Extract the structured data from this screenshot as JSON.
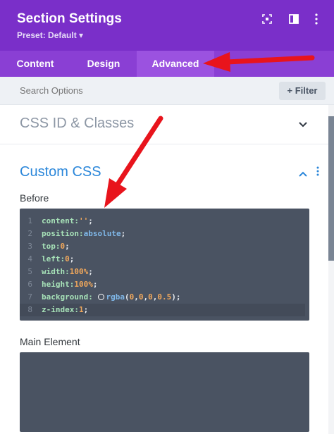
{
  "header": {
    "title": "Section Settings",
    "preset": "Preset: Default ▾",
    "icons": [
      "focus-icon",
      "split-view-icon",
      "more-vertical-icon"
    ]
  },
  "tabs": [
    {
      "label": "Content"
    },
    {
      "label": "Design"
    },
    {
      "label": "Advanced",
      "active": true
    }
  ],
  "search": {
    "placeholder": "Search Options",
    "filter_label": "+ Filter"
  },
  "sections": [
    {
      "title": "CSS ID & Classes",
      "expanded": false
    },
    {
      "title": "Custom CSS",
      "expanded": true
    }
  ],
  "fields": {
    "before_label": "Before",
    "main_label": "Main Element"
  },
  "code": {
    "line_numbers": [
      "1",
      "2",
      "3",
      "4",
      "5",
      "6",
      "7",
      "8"
    ],
    "active_line": 8,
    "l1": {
      "prop": "content:",
      "val": "''",
      "end": ";"
    },
    "l2": {
      "prop": "position:",
      "val": "absolute",
      "end": ";"
    },
    "l3": {
      "prop": "top:",
      "val": "0",
      "end": ";"
    },
    "l4": {
      "prop": "left:",
      "val": "0",
      "end": ";"
    },
    "l5": {
      "prop": "width:",
      "val": "100%",
      "end": ";"
    },
    "l6": {
      "prop": "height:",
      "val": "100%",
      "end": ";"
    },
    "l7": {
      "prop": "background:",
      "fn": "rgba",
      "open": "(",
      "a": "0",
      "b": "0",
      "c": "0",
      "d": "0.5",
      "close": ");"
    },
    "l8": {
      "prop": "z-index:",
      "val": "1",
      "end": ";"
    }
  },
  "colors": {
    "header": "#7a2fc9",
    "tabs": "#8a3fd4",
    "active_tab": "#9b52e0",
    "accent_title": "#2b87da",
    "editor_bg": "#4a5362",
    "annotation_arrow": "#e8141c"
  }
}
